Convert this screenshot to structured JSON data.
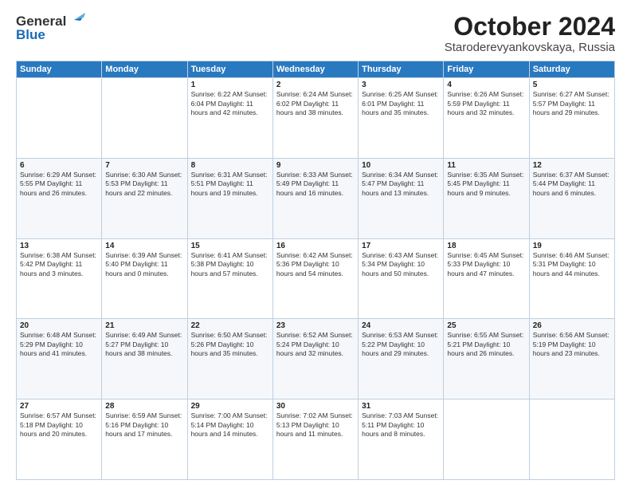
{
  "header": {
    "logo_line1": "General",
    "logo_line2": "Blue",
    "month": "October 2024",
    "location": "Staroderevyankovskaya, Russia"
  },
  "weekdays": [
    "Sunday",
    "Monday",
    "Tuesday",
    "Wednesday",
    "Thursday",
    "Friday",
    "Saturday"
  ],
  "weeks": [
    [
      {
        "num": "",
        "detail": ""
      },
      {
        "num": "",
        "detail": ""
      },
      {
        "num": "1",
        "detail": "Sunrise: 6:22 AM\nSunset: 6:04 PM\nDaylight: 11 hours and 42 minutes."
      },
      {
        "num": "2",
        "detail": "Sunrise: 6:24 AM\nSunset: 6:02 PM\nDaylight: 11 hours and 38 minutes."
      },
      {
        "num": "3",
        "detail": "Sunrise: 6:25 AM\nSunset: 6:01 PM\nDaylight: 11 hours and 35 minutes."
      },
      {
        "num": "4",
        "detail": "Sunrise: 6:26 AM\nSunset: 5:59 PM\nDaylight: 11 hours and 32 minutes."
      },
      {
        "num": "5",
        "detail": "Sunrise: 6:27 AM\nSunset: 5:57 PM\nDaylight: 11 hours and 29 minutes."
      }
    ],
    [
      {
        "num": "6",
        "detail": "Sunrise: 6:29 AM\nSunset: 5:55 PM\nDaylight: 11 hours and 26 minutes."
      },
      {
        "num": "7",
        "detail": "Sunrise: 6:30 AM\nSunset: 5:53 PM\nDaylight: 11 hours and 22 minutes."
      },
      {
        "num": "8",
        "detail": "Sunrise: 6:31 AM\nSunset: 5:51 PM\nDaylight: 11 hours and 19 minutes."
      },
      {
        "num": "9",
        "detail": "Sunrise: 6:33 AM\nSunset: 5:49 PM\nDaylight: 11 hours and 16 minutes."
      },
      {
        "num": "10",
        "detail": "Sunrise: 6:34 AM\nSunset: 5:47 PM\nDaylight: 11 hours and 13 minutes."
      },
      {
        "num": "11",
        "detail": "Sunrise: 6:35 AM\nSunset: 5:45 PM\nDaylight: 11 hours and 9 minutes."
      },
      {
        "num": "12",
        "detail": "Sunrise: 6:37 AM\nSunset: 5:44 PM\nDaylight: 11 hours and 6 minutes."
      }
    ],
    [
      {
        "num": "13",
        "detail": "Sunrise: 6:38 AM\nSunset: 5:42 PM\nDaylight: 11 hours and 3 minutes."
      },
      {
        "num": "14",
        "detail": "Sunrise: 6:39 AM\nSunset: 5:40 PM\nDaylight: 11 hours and 0 minutes."
      },
      {
        "num": "15",
        "detail": "Sunrise: 6:41 AM\nSunset: 5:38 PM\nDaylight: 10 hours and 57 minutes."
      },
      {
        "num": "16",
        "detail": "Sunrise: 6:42 AM\nSunset: 5:36 PM\nDaylight: 10 hours and 54 minutes."
      },
      {
        "num": "17",
        "detail": "Sunrise: 6:43 AM\nSunset: 5:34 PM\nDaylight: 10 hours and 50 minutes."
      },
      {
        "num": "18",
        "detail": "Sunrise: 6:45 AM\nSunset: 5:33 PM\nDaylight: 10 hours and 47 minutes."
      },
      {
        "num": "19",
        "detail": "Sunrise: 6:46 AM\nSunset: 5:31 PM\nDaylight: 10 hours and 44 minutes."
      }
    ],
    [
      {
        "num": "20",
        "detail": "Sunrise: 6:48 AM\nSunset: 5:29 PM\nDaylight: 10 hours and 41 minutes."
      },
      {
        "num": "21",
        "detail": "Sunrise: 6:49 AM\nSunset: 5:27 PM\nDaylight: 10 hours and 38 minutes."
      },
      {
        "num": "22",
        "detail": "Sunrise: 6:50 AM\nSunset: 5:26 PM\nDaylight: 10 hours and 35 minutes."
      },
      {
        "num": "23",
        "detail": "Sunrise: 6:52 AM\nSunset: 5:24 PM\nDaylight: 10 hours and 32 minutes."
      },
      {
        "num": "24",
        "detail": "Sunrise: 6:53 AM\nSunset: 5:22 PM\nDaylight: 10 hours and 29 minutes."
      },
      {
        "num": "25",
        "detail": "Sunrise: 6:55 AM\nSunset: 5:21 PM\nDaylight: 10 hours and 26 minutes."
      },
      {
        "num": "26",
        "detail": "Sunrise: 6:56 AM\nSunset: 5:19 PM\nDaylight: 10 hours and 23 minutes."
      }
    ],
    [
      {
        "num": "27",
        "detail": "Sunrise: 6:57 AM\nSunset: 5:18 PM\nDaylight: 10 hours and 20 minutes."
      },
      {
        "num": "28",
        "detail": "Sunrise: 6:59 AM\nSunset: 5:16 PM\nDaylight: 10 hours and 17 minutes."
      },
      {
        "num": "29",
        "detail": "Sunrise: 7:00 AM\nSunset: 5:14 PM\nDaylight: 10 hours and 14 minutes."
      },
      {
        "num": "30",
        "detail": "Sunrise: 7:02 AM\nSunset: 5:13 PM\nDaylight: 10 hours and 11 minutes."
      },
      {
        "num": "31",
        "detail": "Sunrise: 7:03 AM\nSunset: 5:11 PM\nDaylight: 10 hours and 8 minutes."
      },
      {
        "num": "",
        "detail": ""
      },
      {
        "num": "",
        "detail": ""
      }
    ]
  ]
}
